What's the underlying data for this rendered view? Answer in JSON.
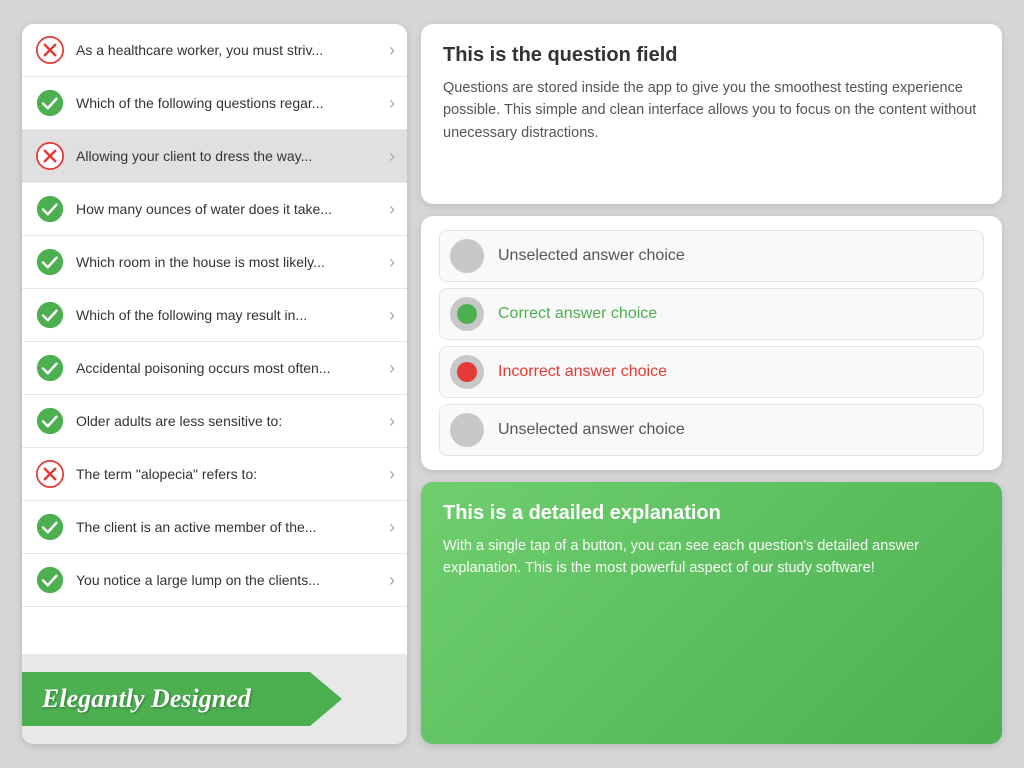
{
  "left_panel": {
    "questions": [
      {
        "id": 1,
        "status": "incorrect",
        "text": "As a healthcare worker, you must striv..."
      },
      {
        "id": 2,
        "status": "correct",
        "text": "Which of the following questions regar..."
      },
      {
        "id": 3,
        "status": "incorrect",
        "text": "Allowing your client to dress the way...",
        "highlighted": true
      },
      {
        "id": 4,
        "status": "correct",
        "text": "How many ounces of water does it take..."
      },
      {
        "id": 5,
        "status": "correct",
        "text": "Which room in the house is most likely..."
      },
      {
        "id": 6,
        "status": "correct",
        "text": "Which of the following may result in..."
      },
      {
        "id": 7,
        "status": "correct",
        "text": "Accidental poisoning occurs most often..."
      },
      {
        "id": 8,
        "status": "correct",
        "text": "Older adults are less sensitive to:"
      },
      {
        "id": 9,
        "status": "incorrect",
        "text": "The term \"alopecia\" refers to:"
      },
      {
        "id": 10,
        "status": "correct",
        "text": "The client is an active member of the..."
      },
      {
        "id": 11,
        "status": "correct",
        "text": "You notice a large lump on the clients..."
      }
    ],
    "banner_text": "Elegantly Designed"
  },
  "right_panel": {
    "question_card": {
      "title": "This is the question field",
      "body": "Questions are stored inside the app to give you the smoothest testing experience possible. This simple and clean interface allows you to focus on the content without unecessary distractions."
    },
    "answers": [
      {
        "id": 1,
        "state": "unselected",
        "label": "Unselected answer choice"
      },
      {
        "id": 2,
        "state": "correct",
        "label": "Correct answer choice"
      },
      {
        "id": 3,
        "state": "incorrect",
        "label": "Incorrect answer choice"
      },
      {
        "id": 4,
        "state": "unselected",
        "label": "Unselected answer choice"
      }
    ],
    "explanation_card": {
      "title": "This is a detailed explanation",
      "body": "With a single tap of a button, you can see each question's detailed answer explanation. This is the most powerful aspect of our study software!"
    }
  }
}
